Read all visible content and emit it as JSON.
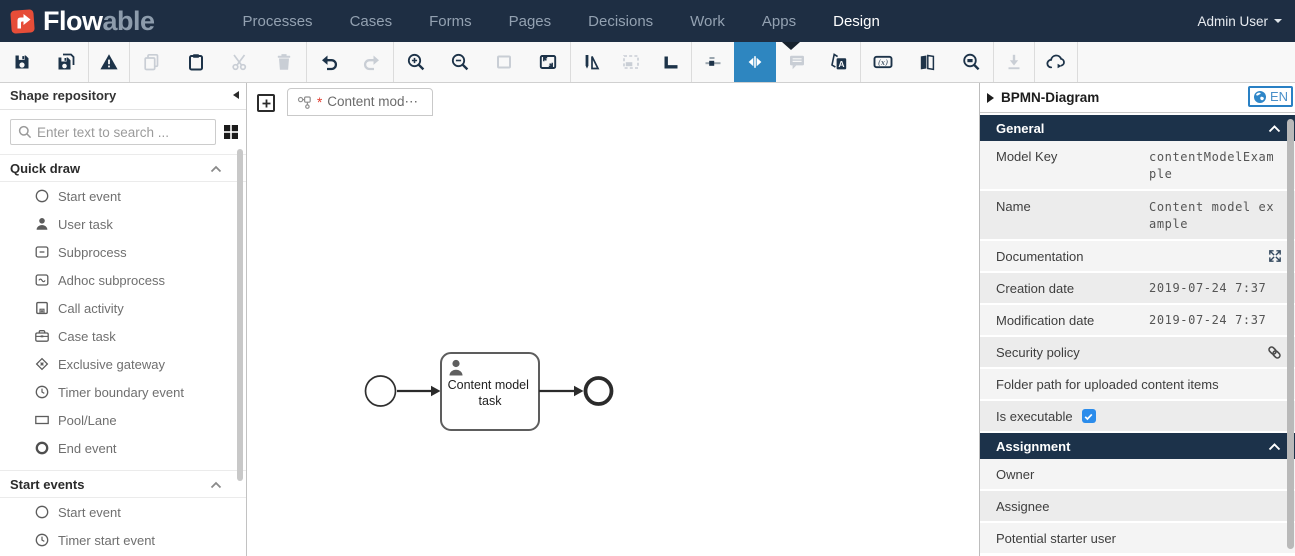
{
  "navbar": {
    "brand_flow": "Flow",
    "brand_able": "able",
    "menu": [
      {
        "label": "Processes",
        "active": false
      },
      {
        "label": "Cases",
        "active": false
      },
      {
        "label": "Forms",
        "active": false
      },
      {
        "label": "Pages",
        "active": false
      },
      {
        "label": "Decisions",
        "active": false
      },
      {
        "label": "Work",
        "active": false
      },
      {
        "label": "Apps",
        "active": false
      },
      {
        "label": "Design",
        "active": true
      }
    ],
    "user_label": "Admin User"
  },
  "toolbar": {
    "buttons": [
      {
        "icon": "save-icon",
        "disabled": false
      },
      {
        "icon": "save-all-icon",
        "disabled": false
      },
      {
        "icon": "validate-icon",
        "disabled": false
      },
      {
        "icon": "copy-icon",
        "disabled": true
      },
      {
        "icon": "paste-icon",
        "disabled": false
      },
      {
        "icon": "cut-icon",
        "disabled": true
      },
      {
        "icon": "delete-icon",
        "disabled": true
      },
      {
        "icon": "undo-icon",
        "disabled": false
      },
      {
        "icon": "redo-icon",
        "disabled": true
      },
      {
        "icon": "zoom-in-icon",
        "disabled": false
      },
      {
        "icon": "zoom-out-icon",
        "disabled": false
      },
      {
        "icon": "zoom-actual-icon",
        "disabled": true
      },
      {
        "icon": "zoom-fit-icon",
        "disabled": false
      },
      {
        "icon": "pen-ruler-icon",
        "disabled": false
      },
      {
        "icon": "marquee-icon",
        "disabled": true
      },
      {
        "icon": "bendpoint-icon",
        "disabled": false
      },
      {
        "icon": "align-icon",
        "disabled": false
      },
      {
        "icon": "spacing-icon",
        "disabled": false,
        "selected": true
      },
      {
        "icon": "comment-icon",
        "disabled": true
      },
      {
        "icon": "translate-icon",
        "disabled": false
      },
      {
        "icon": "expression-icon",
        "disabled": false
      },
      {
        "icon": "glossary-icon",
        "disabled": false
      },
      {
        "icon": "find-icon",
        "disabled": false
      },
      {
        "icon": "download-icon",
        "disabled": true
      },
      {
        "icon": "deploy-icon",
        "disabled": false
      }
    ]
  },
  "sidebar": {
    "title": "Shape repository",
    "search_placeholder": "Enter text to search ...",
    "sections": [
      {
        "title": "Quick draw",
        "items": [
          {
            "icon": "start-event-icon",
            "label": "Start event"
          },
          {
            "icon": "user-task-icon",
            "label": "User task"
          },
          {
            "icon": "subprocess-icon",
            "label": "Subprocess"
          },
          {
            "icon": "adhoc-subprocess-icon",
            "label": "Adhoc subprocess"
          },
          {
            "icon": "call-activity-icon",
            "label": "Call activity"
          },
          {
            "icon": "case-task-icon",
            "label": "Case task"
          },
          {
            "icon": "exclusive-gateway-icon",
            "label": "Exclusive gateway"
          },
          {
            "icon": "timer-boundary-event-icon",
            "label": "Timer boundary event"
          },
          {
            "icon": "pool-lane-icon",
            "label": "Pool/Lane"
          },
          {
            "icon": "end-event-icon",
            "label": "End event"
          }
        ]
      },
      {
        "title": "Start events",
        "items": [
          {
            "icon": "start-event-icon",
            "label": "Start event"
          },
          {
            "icon": "timer-start-event-icon",
            "label": "Timer start event"
          }
        ]
      }
    ]
  },
  "canvas": {
    "tab": {
      "dirty": "*",
      "title": "Content mod⋯"
    },
    "diagram": {
      "task_label": "Content model task",
      "task_label_lines": [
        "Content model",
        "task"
      ]
    }
  },
  "panel": {
    "title": "BPMN-Diagram",
    "language": "EN",
    "sections": [
      {
        "title": "General",
        "rows": [
          {
            "label": "Model Key",
            "value": "contentModelExample"
          },
          {
            "label": "Name",
            "value": "Content model example"
          },
          {
            "label": "Documentation",
            "icon": "expand-icon"
          },
          {
            "label": "Creation date",
            "value": "2019-07-24 7:37"
          },
          {
            "label": "Modification date",
            "value": "2019-07-24 7:37"
          },
          {
            "label": "Security policy",
            "icon": "link-icon"
          },
          {
            "label": "Folder path for uploaded content items"
          },
          {
            "label": "Is executable",
            "checked": true
          }
        ]
      },
      {
        "title": "Assignment",
        "rows": [
          {
            "label": "Owner"
          },
          {
            "label": "Assignee"
          },
          {
            "label": "Potential starter user"
          }
        ]
      }
    ]
  },
  "colors": {
    "navbar_bg": "#1e2e43",
    "brand_orange": "#e64d38",
    "accent_blue": "#2e86c8",
    "selected_tool_bg": "#2e86c0",
    "section_header_bg": "#1c324a",
    "checkbox_blue": "#2b8ceb",
    "dirty_marker_red": "#e23b2e"
  }
}
